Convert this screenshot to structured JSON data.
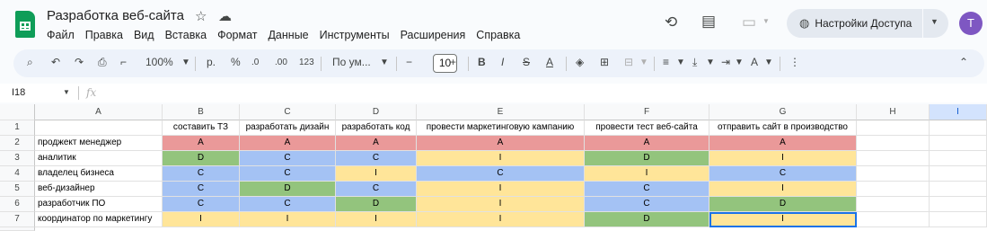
{
  "doc": {
    "title": "Разработка веб-сайта"
  },
  "menu": [
    "Файл",
    "Правка",
    "Вид",
    "Вставка",
    "Формат",
    "Данные",
    "Инструменты",
    "Расширения",
    "Справка"
  ],
  "share": {
    "label": "Настройки Доступа"
  },
  "user": {
    "initial": "T",
    "color": "#7e57c2"
  },
  "toolbar": {
    "zoom": "100%",
    "currency": "р.",
    "percent": "%",
    "dec_decrease": ".0",
    "dec_increase": ".00",
    "number_format": "123",
    "font": "По ум...",
    "font_size": "10",
    "bold": "B",
    "italic": "I",
    "text_color": "A"
  },
  "formula": {
    "cell_ref": "I18",
    "fx": "fx",
    "value": ""
  },
  "sheet": {
    "columns": [
      "A",
      "B",
      "C",
      "D",
      "E",
      "F",
      "G",
      "H",
      "I"
    ],
    "row_numbers": [
      "1",
      "2",
      "3",
      "4",
      "5",
      "6",
      "7"
    ],
    "rows": [
      [
        "",
        "составить ТЗ",
        "разработать дизайн",
        "разработать код",
        "провести маркетинговую кампанию",
        "провести тест веб-сайта",
        "отправить сайт в производство"
      ],
      [
        "проджект менеджер",
        "A",
        "A",
        "A",
        "A",
        "A",
        "A"
      ],
      [
        "аналитик",
        "D",
        "C",
        "C",
        "I",
        "D",
        "I"
      ],
      [
        "владелец бизнеса",
        "C",
        "C",
        "I",
        "C",
        "I",
        "C"
      ],
      [
        "веб-дизайнер",
        "C",
        "D",
        "C",
        "I",
        "C",
        "I"
      ],
      [
        "разработчик ПО",
        "C",
        "C",
        "D",
        "I",
        "C",
        "D"
      ],
      [
        "координатор по маркетингу",
        "I",
        "I",
        "I",
        "I",
        "D",
        "I"
      ]
    ]
  },
  "colors": {
    "A": "#ea9999",
    "C": "#a4c2f4",
    "D": "#93c47d",
    "I": "#ffe599"
  }
}
